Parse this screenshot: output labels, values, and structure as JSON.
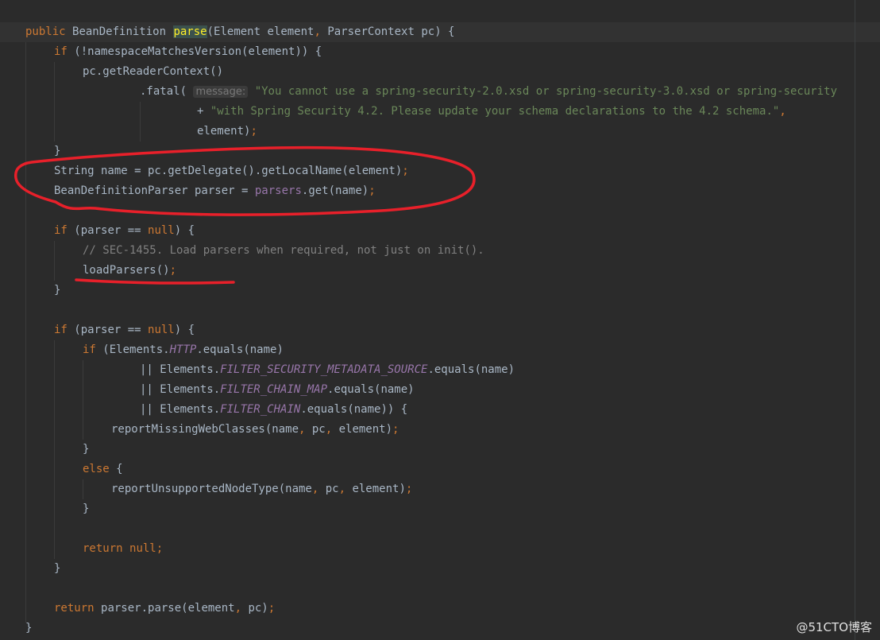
{
  "colors": {
    "background": "#2b2b2b",
    "keyword": "#cc7832",
    "default_text": "#a9b7c6",
    "string": "#6a8759",
    "comment": "#808080",
    "field": "#9876aa",
    "method_declaration": "#ffc66d",
    "annotation_ink": "#e8202a"
  },
  "code": {
    "l1": {
      "kw1": "public ",
      "t1": "BeanDefinition ",
      "fn": "parse",
      "t2": "(Element element",
      "kw2": ", ",
      "t3": "ParserContext pc) {"
    },
    "l2": {
      "kw": "if ",
      "t": "(!namespaceMatchesVersion(element)) {"
    },
    "l3": {
      "t": "pc.getReaderContext()"
    },
    "l4": {
      "t": ".fatal(",
      "hint": "message:",
      "str": "\"You cannot use a spring-security-2.0.xsd or spring-security-3.0.xsd or spring-security"
    },
    "l5": {
      "t": "+ ",
      "str": "\"with Spring Security 4.2. Please update your schema declarations to the 4.2 schema.\"",
      "kw": ","
    },
    "l6": {
      "t": "element)",
      "kw": ";"
    },
    "l7": {
      "t": "}"
    },
    "l8": {
      "t": "String name = pc.getDelegate().getLocalName(element)",
      "kw": ";"
    },
    "l9": {
      "t1": "BeanDefinitionParser parser = ",
      "fld": "parsers",
      "t2": ".get(name)",
      "kw": ";"
    },
    "l10": {
      "t": ""
    },
    "l11": {
      "kw1": "if ",
      "t1": "(parser == ",
      "kw2": "null",
      "t2": ") {"
    },
    "l12": {
      "cmt": "// SEC-1455. Load parsers when required, not just on init()."
    },
    "l13": {
      "t": "loadParsers()",
      "kw": ";"
    },
    "l14": {
      "t": "}"
    },
    "l15": {
      "t": ""
    },
    "l16": {
      "kw1": "if ",
      "t1": "(parser == ",
      "kw2": "null",
      "t2": ") {"
    },
    "l17": {
      "kw": "if ",
      "t1": "(Elements.",
      "ital": "HTTP",
      "t2": ".equals(name)"
    },
    "l18": {
      "t1": "|| Elements.",
      "ital": "FILTER_SECURITY_METADATA_SOURCE",
      "t2": ".equals(name)"
    },
    "l19": {
      "t1": "|| Elements.",
      "ital": "FILTER_CHAIN_MAP",
      "t2": ".equals(name)"
    },
    "l20": {
      "t1": "|| Elements.",
      "ital": "FILTER_CHAIN",
      "t2": ".equals(name)) {"
    },
    "l21": {
      "t1": "reportMissingWebClasses(name",
      "k1": ", ",
      "t2": "pc",
      "k2": ", ",
      "t3": "element)",
      "k3": ";"
    },
    "l22": {
      "t": "}"
    },
    "l23": {
      "kw": "else ",
      "t": "{"
    },
    "l24": {
      "t1": "reportUnsupportedNodeType(name",
      "k1": ", ",
      "t2": "pc",
      "k2": ", ",
      "t3": "element)",
      "k3": ";"
    },
    "l25": {
      "t": "}"
    },
    "l26": {
      "t": ""
    },
    "l27": {
      "kw1": "return ",
      "kw2": "null;"
    },
    "l28": {
      "t": "}"
    },
    "l29": {
      "t": ""
    },
    "l30": {
      "kw1": "return ",
      "t": "parser.parse(element",
      "kw2": ", ",
      "t2": "pc)",
      "kw3": ";"
    },
    "l31": {
      "t": "}"
    }
  },
  "watermark": "@51CTO博客"
}
